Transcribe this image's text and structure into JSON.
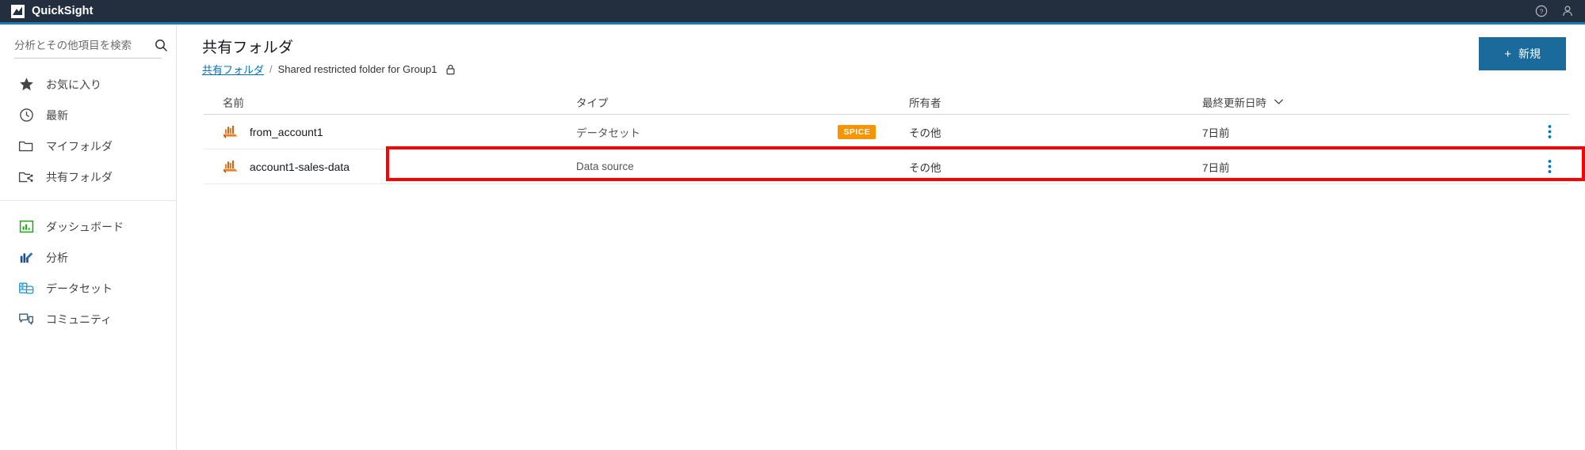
{
  "topbar": {
    "logo_icon": "quicksight-logo-icon",
    "product_title": "QuickSight",
    "help_icon": "help-circle-icon",
    "user_icon": "user-account-icon",
    "accent_color": "#1a7bb9",
    "background_color": "#232f3e"
  },
  "sidebar": {
    "search": {
      "placeholder": "分析とその他項目を検索",
      "value": "",
      "icon": "search-icon"
    },
    "groups": [
      {
        "items": [
          {
            "label": "お気に入り",
            "icon": "star-icon"
          },
          {
            "label": "最新",
            "icon": "clock-icon"
          },
          {
            "label": "マイフォルダ",
            "icon": "folder-icon"
          },
          {
            "label": "共有フォルダ",
            "icon": "shared-folder-icon"
          }
        ]
      },
      {
        "items": [
          {
            "label": "ダッシュボード",
            "icon": "dashboard-icon",
            "color": "#1aa616"
          },
          {
            "label": "分析",
            "icon": "analysis-icon",
            "color": "#1b4f8a"
          },
          {
            "label": "データセット",
            "icon": "dataset-icon",
            "color": "#2196d6"
          },
          {
            "label": "コミュニティ",
            "icon": "community-icon",
            "color": "#3f5a73"
          }
        ]
      }
    ]
  },
  "main": {
    "page_title": "共有フォルダ",
    "breadcrumb": {
      "root_label": "共有フォルダ",
      "separator": "/",
      "current_label": "Shared restricted folder for Group1",
      "lock_icon": "lock-icon"
    },
    "new_button": {
      "label": "新規",
      "plus": "+",
      "color": "#1a6b9c"
    },
    "table": {
      "columns": [
        {
          "key": "name",
          "label": "名前"
        },
        {
          "key": "type",
          "label": "タイプ"
        },
        {
          "key": "owner",
          "label": "所有者"
        },
        {
          "key": "date",
          "label": "最終更新日時",
          "sort_icon": "chevron-down-icon"
        }
      ],
      "rows": [
        {
          "icon": "dataset-orange-icon",
          "name": "from_account1",
          "type": "データセット",
          "badge": "SPICE",
          "badge_color": "#f79400",
          "owner": "その他",
          "date": "7日前",
          "menu_icon": "kebab-menu-icon",
          "highlighted": true
        },
        {
          "icon": "dataset-orange-icon",
          "name": "account1-sales-data",
          "type": "Data source",
          "badge": "",
          "owner": "その他",
          "date": "7日前",
          "menu_icon": "kebab-menu-icon",
          "highlighted": false
        }
      ]
    },
    "highlight_color": "#ff0000"
  }
}
